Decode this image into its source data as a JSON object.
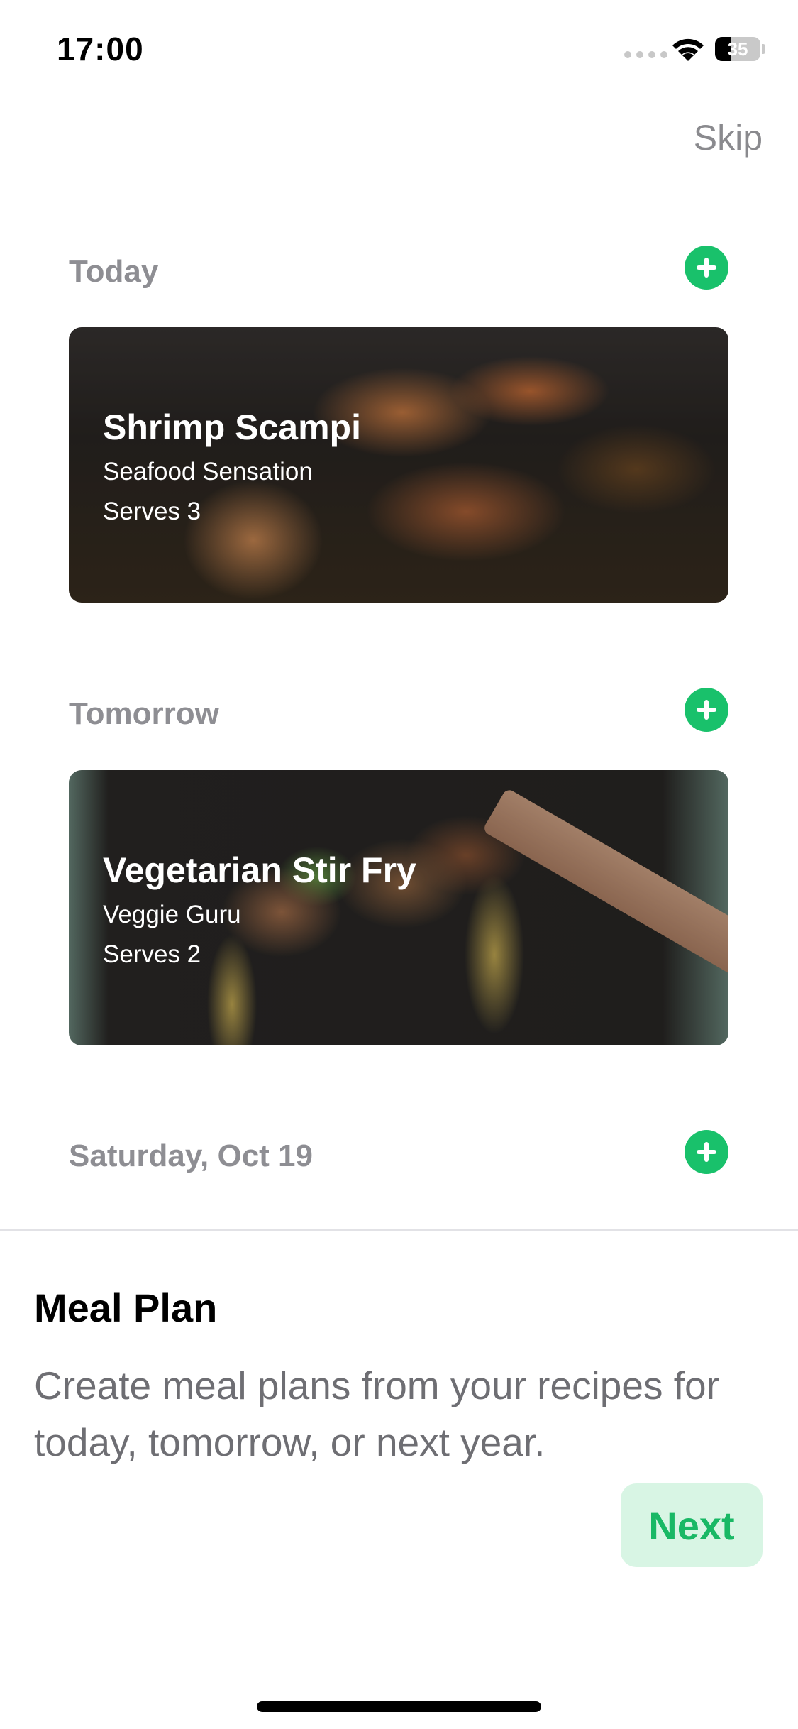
{
  "status_bar": {
    "time": "17:00",
    "battery": "35",
    "battery_level_pct": 35
  },
  "header": {
    "skip_label": "Skip"
  },
  "sections": [
    {
      "day": "Today",
      "recipe": {
        "title": "Shrimp Scampi",
        "author": "Seafood Sensation",
        "serves": "Serves 3"
      }
    },
    {
      "day": "Tomorrow",
      "recipe": {
        "title": "Vegetarian Stir Fry",
        "author": "Veggie Guru",
        "serves": "Serves 2"
      }
    },
    {
      "day": "Saturday, Oct 19"
    }
  ],
  "panel": {
    "title": "Meal Plan",
    "description": "Create meal plans from your recipes for today, tomorrow, or next year.",
    "next_label": "Next"
  },
  "colors": {
    "accent": "#19c16b",
    "next_bg": "#d8f5e4",
    "muted": "#8e8e93"
  },
  "icons": [
    "wifi-icon",
    "battery-icon",
    "plus-icon"
  ]
}
